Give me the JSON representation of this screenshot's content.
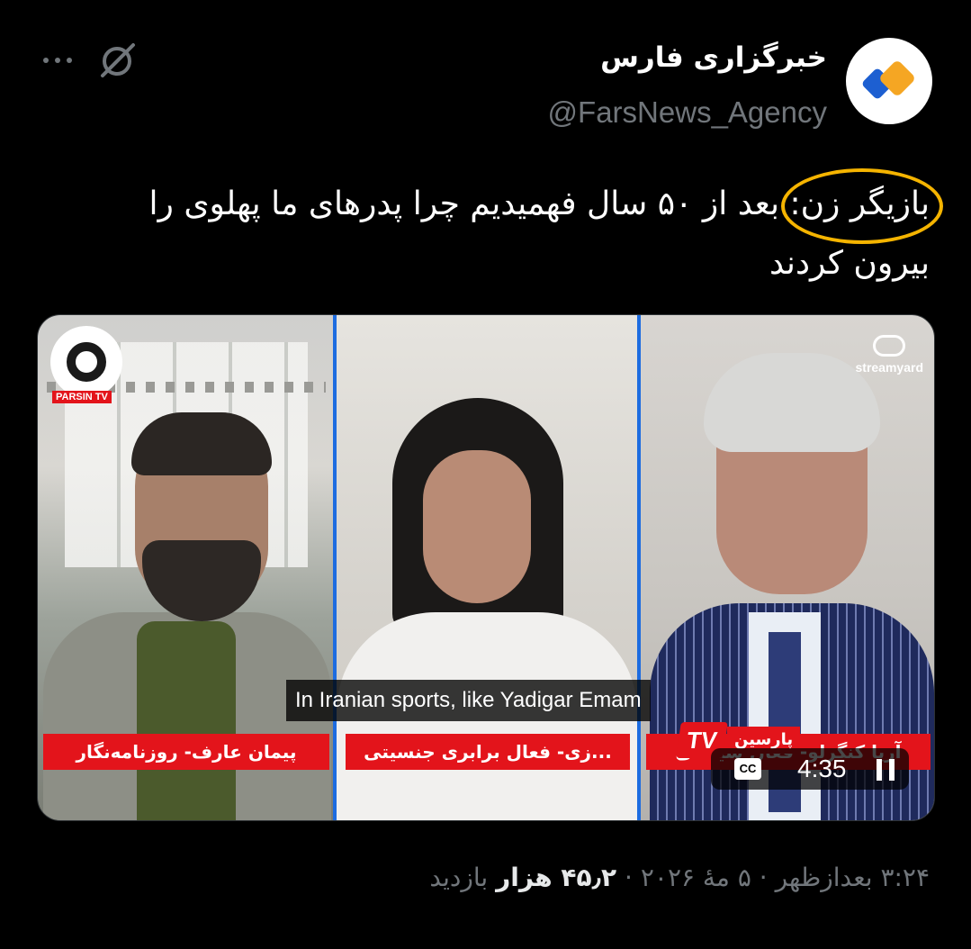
{
  "author": {
    "display_name": "خبرگزاری فارس",
    "handle": "@FarsNews_Agency",
    "avatar_colors": [
      "#f5a623",
      "#1d5fd1"
    ]
  },
  "header_icons": {
    "more": "more-horizontal-icon",
    "grok": "grok-icon"
  },
  "tweet": {
    "text": "بازیگر زن: بعد از ۵۰ سال فهمیدیم چرا پدرهای ما پهلوی را بیرون کردند",
    "highlight_color": "#f5b400"
  },
  "media": {
    "watermark_left": "PARSIN TV",
    "watermark_right": "streamyard",
    "name_bars": [
      "پیمان عارف- روزنامه‌نگار",
      "...زی- فعال برابری جنسیتی",
      "آریا کنگرلو- فعال سیاسی"
    ],
    "subtitle": "In Iranian sports, like Yadigar Emam",
    "channel_badge": {
      "tv": "TV",
      "name": "پارسین"
    },
    "cc_label": "CC",
    "time_remaining": "4:35",
    "accent_red": "#e3141b"
  },
  "meta": {
    "time": "۳:۲۴ بعدازظهر",
    "separator": "·",
    "date": "۵ مهٔ ۲۰۲۶",
    "views_count": "۴۵٫۲ هزار",
    "views_label": "بازدید"
  }
}
